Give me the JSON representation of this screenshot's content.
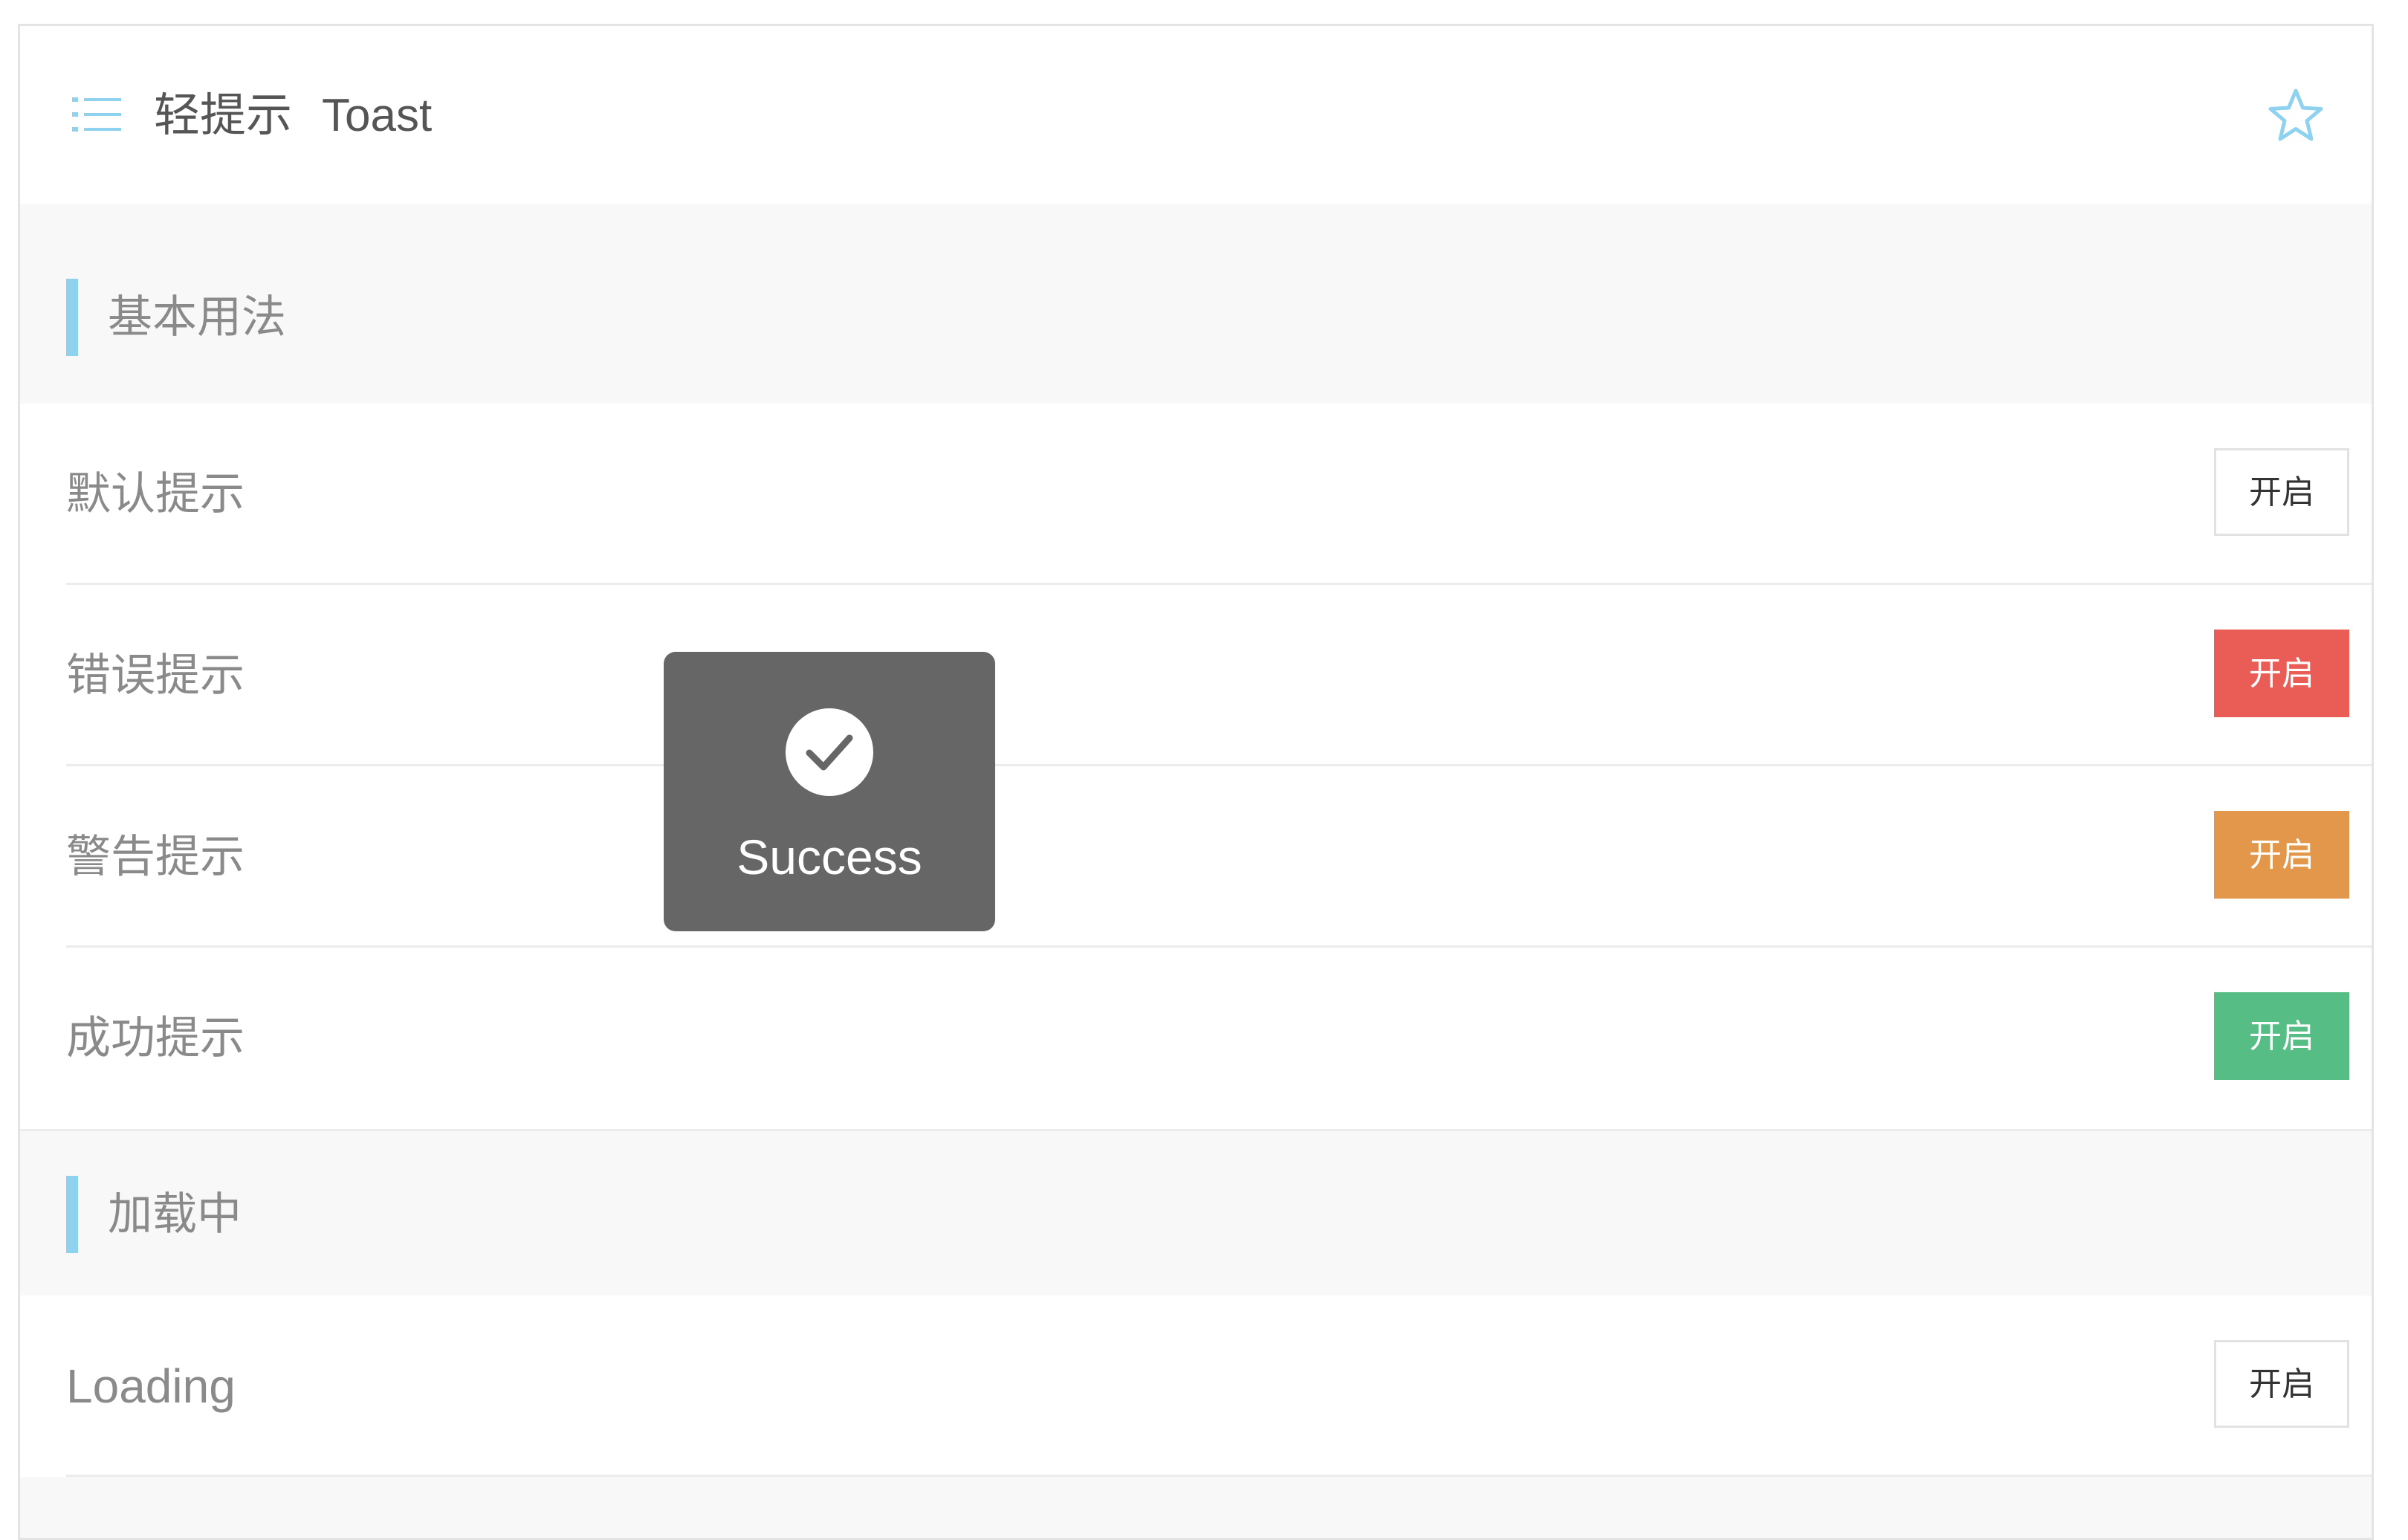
{
  "header": {
    "title_cn": "轻提示",
    "title_en": "Toast",
    "menu_icon": "list-icon",
    "favorite_icon": "star-icon"
  },
  "sections": [
    {
      "label": "基本用法"
    },
    {
      "label": "加载中"
    }
  ],
  "rows": [
    {
      "label": "默认提示",
      "button": "开启",
      "variant": "default"
    },
    {
      "label": "错误提示",
      "button": "开启",
      "variant": "error"
    },
    {
      "label": "警告提示",
      "button": "开启",
      "variant": "warning"
    },
    {
      "label": "成功提示",
      "button": "开启",
      "variant": "success"
    },
    {
      "label": "Loading",
      "button": "开启",
      "variant": "default"
    }
  ],
  "toast": {
    "icon": "check-circle-icon",
    "text": "Success"
  },
  "colors": {
    "accent": "#8fd2ef",
    "error": "#ea5d57",
    "warning": "#e2974a",
    "success": "#56bd85",
    "toast_bg": "#666666"
  }
}
